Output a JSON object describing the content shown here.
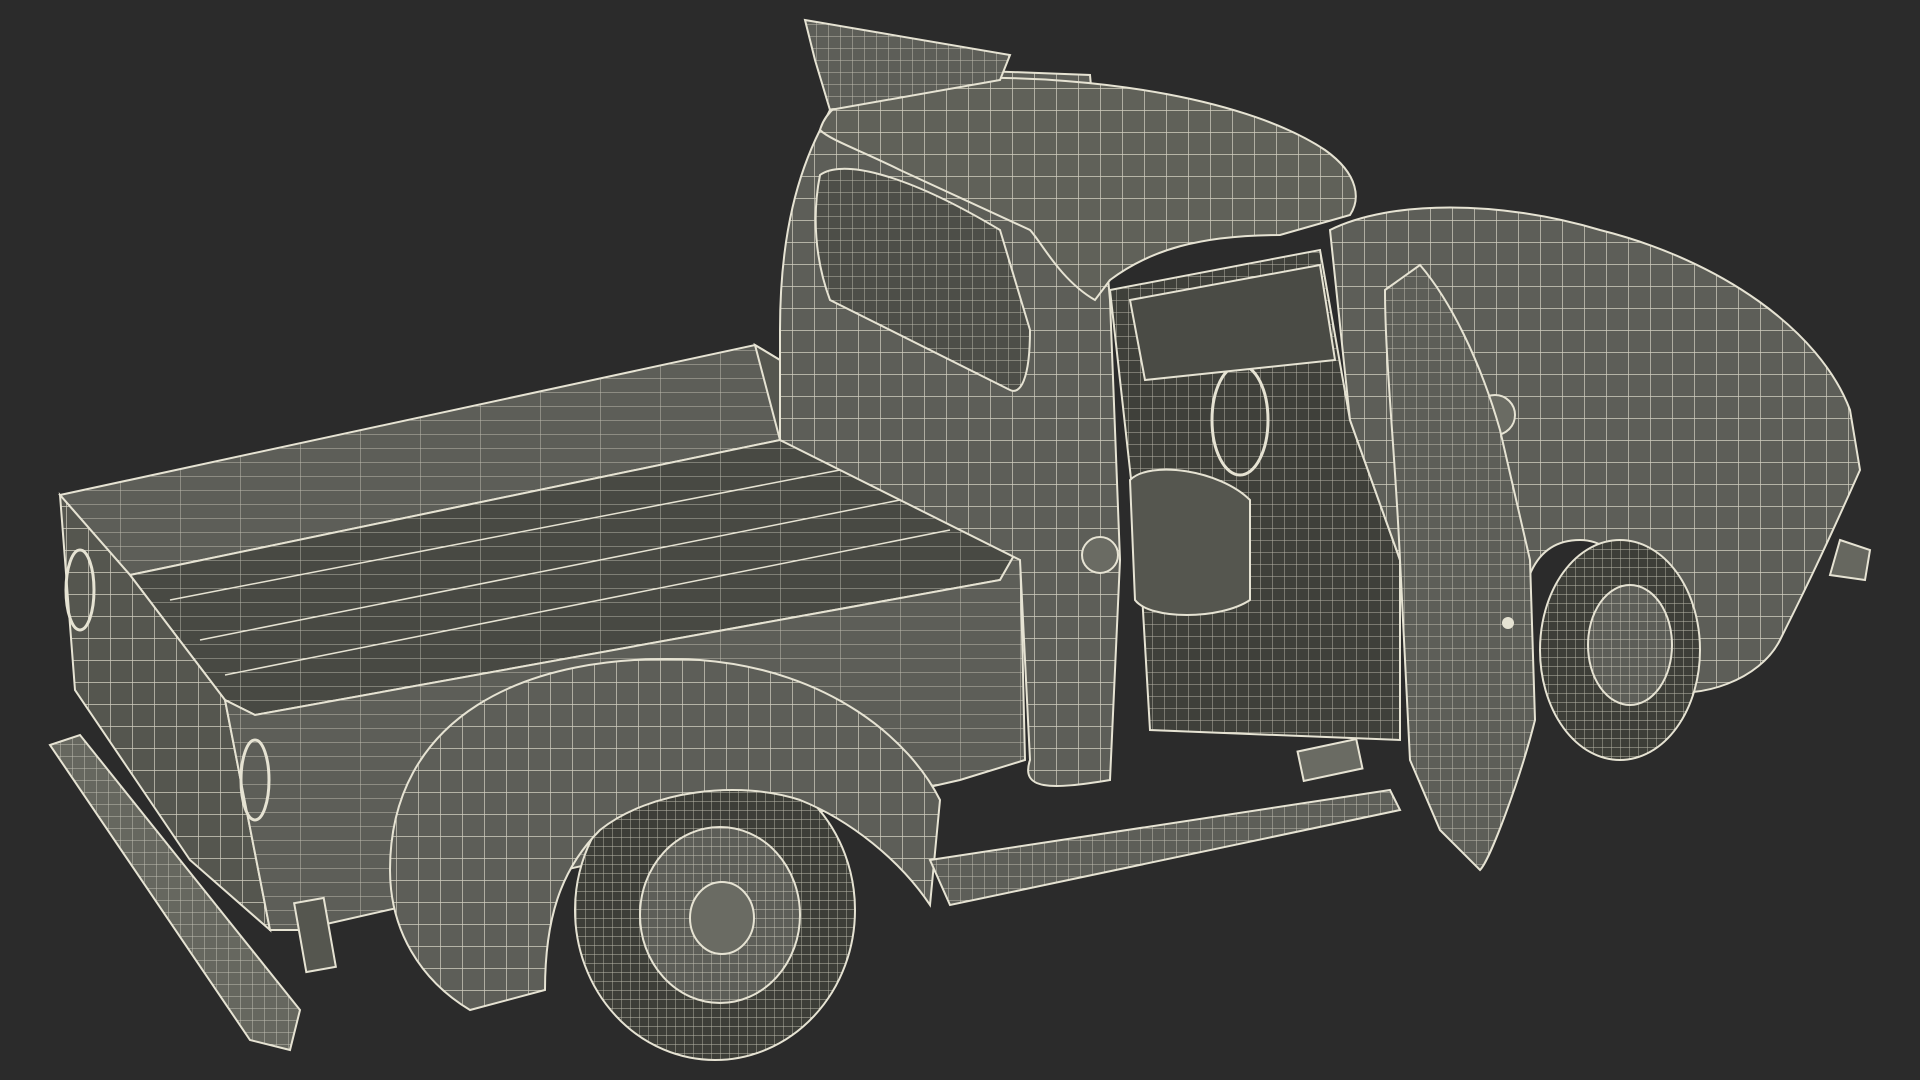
{
  "scene": {
    "subject": "wireframe-pickup-truck",
    "background_color": "#2b2b2b",
    "surface_color": "#5d5e58",
    "surface_shadow_color": "#45463f",
    "wire_color": "#e6e3d3"
  }
}
